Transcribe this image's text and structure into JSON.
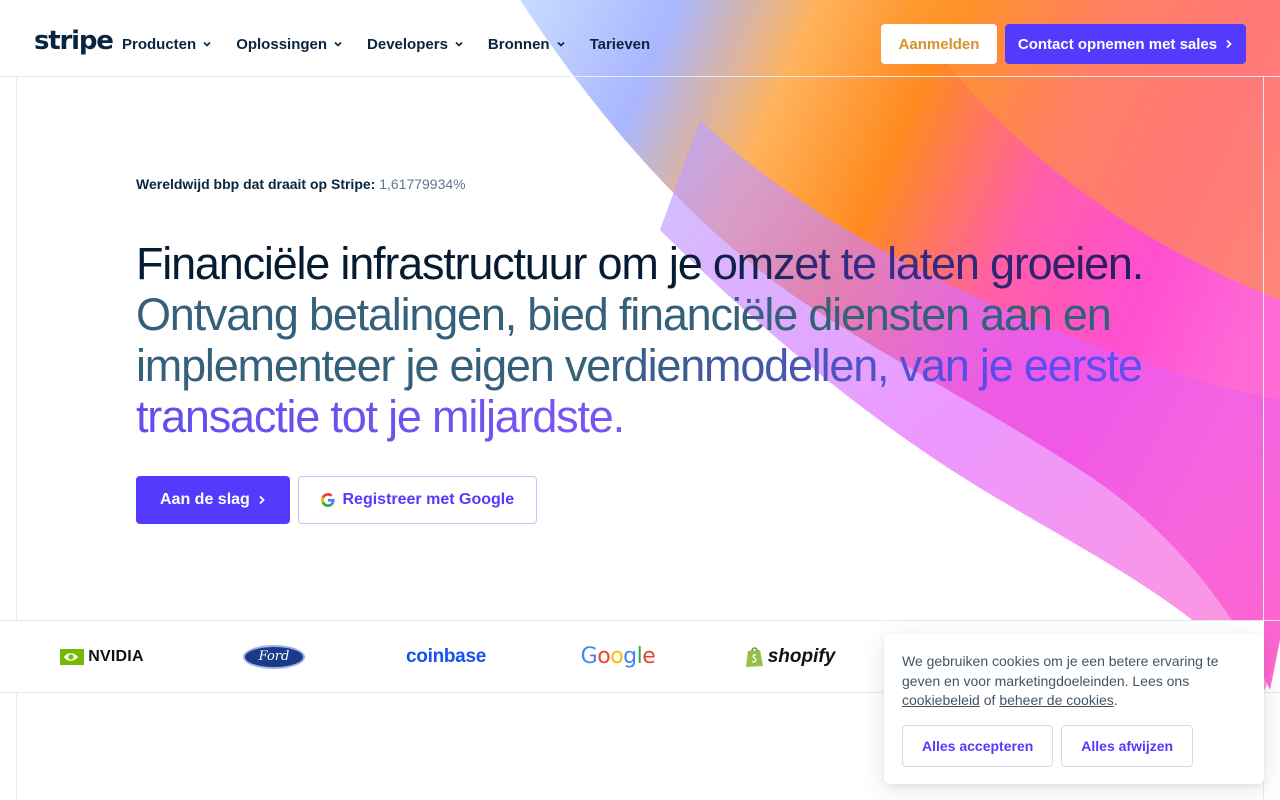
{
  "header": {
    "logo": "stripe",
    "nav": [
      {
        "label": "Producten",
        "dropdown": true
      },
      {
        "label": "Oplossingen",
        "dropdown": true
      },
      {
        "label": "Developers",
        "dropdown": true
      },
      {
        "label": "Bronnen",
        "dropdown": true
      },
      {
        "label": "Tarieven",
        "dropdown": false
      }
    ],
    "login_label": "Aanmelden",
    "sales_label": "Contact opnemen met sales"
  },
  "hero": {
    "gdp_label": "Wereldwijd bbp dat draait op Stripe:",
    "gdp_value": "1,61779934%",
    "headline_strong": "Financiële infrastructuur om je omzet te laten groeien.",
    "headline_rest": "Ontvang betalingen, bied financiële diensten aan en implementeer je eigen verdienmodellen, van je eerste transactie tot je miljardste.",
    "cta_start": "Aan de slag",
    "cta_google": "Registreer met Google"
  },
  "logos": [
    {
      "name": "NVIDIA"
    },
    {
      "name": "Ford"
    },
    {
      "name": "coinbase"
    },
    {
      "name": "Google"
    },
    {
      "name": "shopify"
    }
  ],
  "cookie": {
    "text_before": "We gebruiken cookies om je een betere ervaring te geven en voor marketingdoeleinden. Lees ons",
    "link_policy": "cookiebeleid",
    "text_middle": "of",
    "link_manage": "beheer de cookies",
    "text_end": ".",
    "accept_label": "Alles accepteren",
    "reject_label": "Alles afwijzen"
  },
  "colors": {
    "accent": "#533afd",
    "navy": "#0a2540",
    "login_text": "#d8902d"
  },
  "icons": [
    "chevron-down-icon",
    "chevron-right-icon",
    "google-g-icon",
    "nvidia-eye-icon",
    "shopify-bag-icon"
  ]
}
